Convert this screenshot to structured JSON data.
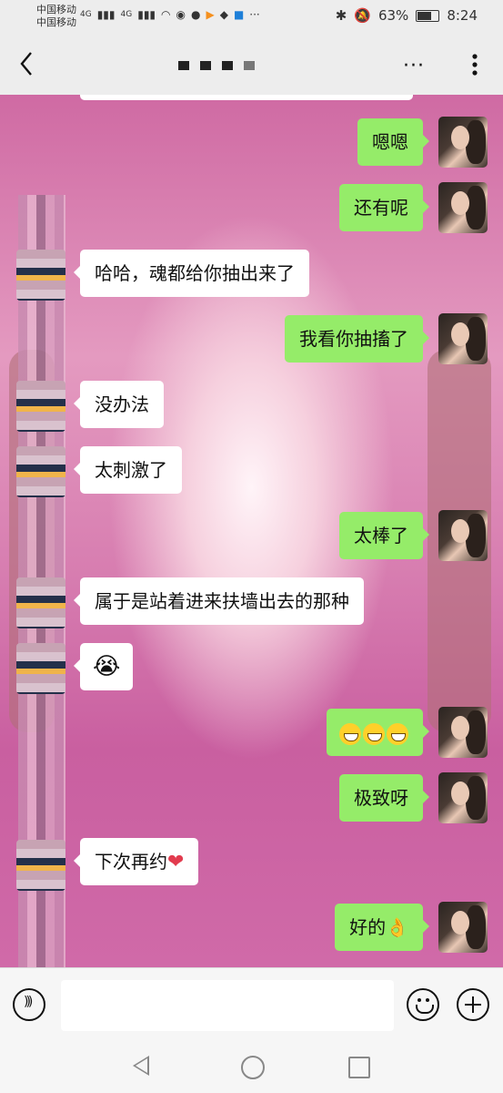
{
  "status_bar": {
    "carrier_1": "中国移动",
    "carrier_2": "中国移动",
    "network_1": "4G",
    "network_2": "4G",
    "battery_percent": "63%",
    "battery_level": 0.63,
    "time": "8:24"
  },
  "header": {
    "back_icon": "chevron-left-icon",
    "more_label": "···"
  },
  "messages": [
    {
      "side": "out",
      "text": "嗯嗯"
    },
    {
      "side": "out",
      "text": "还有呢"
    },
    {
      "side": "in",
      "text": "哈哈，魂都给你抽出来了"
    },
    {
      "side": "out",
      "text": "我看你抽搐了"
    },
    {
      "side": "in",
      "text": "没办法"
    },
    {
      "side": "in",
      "text": "太刺激了"
    },
    {
      "side": "out",
      "text": "太棒了"
    },
    {
      "side": "in",
      "text": "属于是站着进来扶墙出去的那种"
    },
    {
      "side": "in",
      "text": "😭",
      "emoji": "crying-laughing"
    },
    {
      "side": "out",
      "text": "",
      "emoji": "grinning x3"
    },
    {
      "side": "out",
      "text": "极致呀"
    },
    {
      "side": "in",
      "text": "下次再约",
      "suffix": "❤"
    },
    {
      "side": "out",
      "text": "好的",
      "suffix": "👌"
    }
  ],
  "input": {
    "placeholder": ""
  },
  "colors": {
    "bubble_out": "#95ec69",
    "bubble_in": "#ffffff",
    "bar_bg": "#ededed"
  }
}
